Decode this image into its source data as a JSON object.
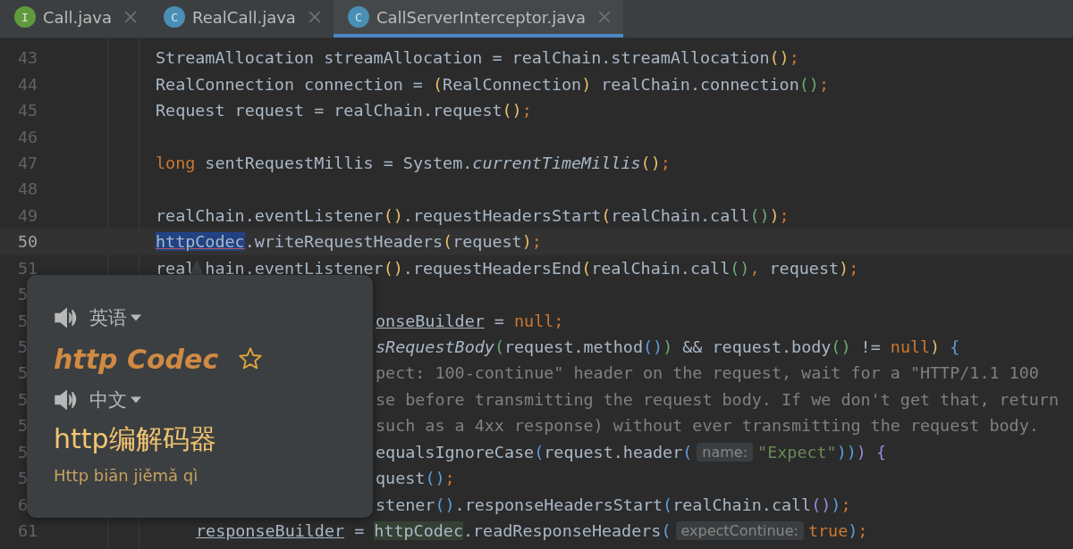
{
  "tabs": [
    {
      "icon_letter": "I",
      "color": "#5f9a3c",
      "label": "Call.java",
      "selected": false
    },
    {
      "icon_letter": "C",
      "color": "#4a8fb5",
      "label": "RealCall.java",
      "selected": false
    },
    {
      "icon_letter": "C",
      "color": "#4a8fb5",
      "label": "CallServerInterceptor.java",
      "selected": true
    }
  ],
  "editor": {
    "lines": [
      {
        "number": "43",
        "kind": "code",
        "current": false,
        "segments": [
          {
            "kind": "plain",
            "text": "StreamAllocation streamAllocation = realChain.streamAllocation"
          },
          {
            "kind": "paren-yellow",
            "text": "()"
          },
          {
            "kind": "punct",
            "text": ";"
          }
        ]
      },
      {
        "number": "44",
        "kind": "code",
        "current": false,
        "segments": [
          {
            "kind": "plain",
            "text": "RealConnection connection = "
          },
          {
            "kind": "paren-yellow",
            "text": "("
          },
          {
            "kind": "plain",
            "text": "RealConnection"
          },
          {
            "kind": "paren-yellow",
            "text": ")"
          },
          {
            "kind": "plain",
            "text": " realChain.connection"
          },
          {
            "kind": "paren-green",
            "text": "()"
          },
          {
            "kind": "punct",
            "text": ";"
          }
        ]
      },
      {
        "number": "45",
        "kind": "code",
        "current": false,
        "segments": [
          {
            "kind": "plain",
            "text": "Request request = realChain.request"
          },
          {
            "kind": "paren-yellow",
            "text": "()"
          },
          {
            "kind": "punct",
            "text": ";"
          }
        ]
      },
      {
        "number": "46",
        "kind": "code",
        "current": false
      },
      {
        "number": "47",
        "kind": "code",
        "current": false,
        "segments": [
          {
            "kind": "keyword",
            "text": "long"
          },
          {
            "kind": "plain",
            "text": " sentRequestMillis = System."
          },
          {
            "kind": "italic",
            "text": "currentTimeMillis"
          },
          {
            "kind": "paren-yellow",
            "text": "()"
          },
          {
            "kind": "punct",
            "text": ";"
          }
        ]
      },
      {
        "number": "48",
        "kind": "code",
        "current": false
      },
      {
        "number": "49",
        "kind": "code",
        "current": false,
        "segments": [
          {
            "kind": "plain",
            "text": "realChain.eventListener"
          },
          {
            "kind": "paren-yellow",
            "text": "()"
          },
          {
            "kind": "plain",
            "text": ".requestHeadersStart"
          },
          {
            "kind": "paren-yellow",
            "text": "("
          },
          {
            "kind": "plain",
            "text": "realChain.call"
          },
          {
            "kind": "paren-green",
            "text": "()"
          },
          {
            "kind": "paren-yellow",
            "text": ")"
          },
          {
            "kind": "punct",
            "text": ";"
          }
        ]
      },
      {
        "number": "50",
        "kind": "code",
        "current": true,
        "segments": [
          {
            "kind": "selected",
            "text": "httpCodec"
          },
          {
            "kind": "plain",
            "text": ".writeRequestHeaders"
          },
          {
            "kind": "paren-yellow",
            "text": "("
          },
          {
            "kind": "plain",
            "text": "request"
          },
          {
            "kind": "paren-yellow",
            "text": ")"
          },
          {
            "kind": "punct",
            "text": ";"
          }
        ]
      },
      {
        "number": "51",
        "kind": "code",
        "current": false,
        "segments": [
          {
            "kind": "plain",
            "text": "real"
          },
          {
            "kind": "gap"
          },
          {
            "kind": "plain",
            "text": "hain.eventListener"
          },
          {
            "kind": "paren-yellow",
            "text": "()"
          },
          {
            "kind": "plain",
            "text": ".requestHeadersEnd"
          },
          {
            "kind": "paren-yellow",
            "text": "("
          },
          {
            "kind": "plain",
            "text": "realChain.call"
          },
          {
            "kind": "paren-green",
            "text": "()"
          },
          {
            "kind": "punct",
            "text": ","
          },
          {
            "kind": "plain",
            "text": " request"
          },
          {
            "kind": "paren-yellow",
            "text": ")"
          },
          {
            "kind": "punct",
            "text": ";"
          }
        ]
      },
      {
        "number": "5",
        "kind": "partial",
        "current": false
      },
      {
        "number": "5",
        "kind": "partial",
        "current": false,
        "segments": [
          {
            "kind": "field",
            "text": "onseBuilder"
          },
          {
            "kind": "plain",
            "text": " = "
          },
          {
            "kind": "keyword",
            "text": "null"
          },
          {
            "kind": "punct",
            "text": ";"
          }
        ]
      },
      {
        "number": "5",
        "kind": "partial",
        "current": false,
        "segments": [
          {
            "kind": "italic",
            "text": "sRequestBody"
          },
          {
            "kind": "paren-green",
            "text": "("
          },
          {
            "kind": "plain",
            "text": "request.method"
          },
          {
            "kind": "paren-blue",
            "text": "()"
          },
          {
            "kind": "paren-green",
            "text": ")"
          },
          {
            "kind": "plain",
            "text": " && request.body"
          },
          {
            "kind": "paren-green",
            "text": "()"
          },
          {
            "kind": "plain",
            "text": " != "
          },
          {
            "kind": "keyword",
            "text": "null"
          },
          {
            "kind": "paren-yellow",
            "text": ")"
          },
          {
            "kind": "paren-blue",
            "text": " {"
          }
        ]
      },
      {
        "number": "5",
        "kind": "partial",
        "current": false,
        "segments": [
          {
            "kind": "comment",
            "text": "pect: 100-continue\" header on the request, wait for a \"HTTP/1.1 100"
          }
        ]
      },
      {
        "number": "5",
        "kind": "partial",
        "current": false,
        "segments": [
          {
            "kind": "comment",
            "text": "se before transmitting the request body. If we don't get that, return"
          }
        ]
      },
      {
        "number": "5",
        "kind": "partial",
        "current": false,
        "segments": [
          {
            "kind": "comment",
            "text": "such as a 4xx response) without ever transmitting the request body."
          }
        ]
      },
      {
        "number": "5",
        "kind": "partial",
        "current": false,
        "segments": [
          {
            "kind": "plain",
            "text": "equalsIgnoreCase"
          },
          {
            "kind": "paren-blue",
            "text": "("
          },
          {
            "kind": "plain",
            "text": "request.header"
          },
          {
            "kind": "paren-blue",
            "text": "("
          },
          {
            "kind": "hint",
            "text": "name:"
          },
          {
            "kind": "string",
            "text": "\"Expect\""
          },
          {
            "kind": "paren-blue",
            "text": ")"
          },
          {
            "kind": "paren-blue",
            "text": ")"
          },
          {
            "kind": "paren-purple",
            "text": ")"
          },
          {
            "kind": "paren-purple",
            "text": " {"
          }
        ]
      },
      {
        "number": "5",
        "kind": "partial",
        "current": false,
        "segments": [
          {
            "kind": "plain",
            "text": "quest"
          },
          {
            "kind": "paren-blue",
            "text": "()"
          },
          {
            "kind": "punct",
            "text": ";"
          }
        ]
      },
      {
        "number": "6",
        "kind": "partial",
        "current": false,
        "segments": [
          {
            "kind": "plain",
            "text": "stener"
          },
          {
            "kind": "paren-blue",
            "text": "()"
          },
          {
            "kind": "plain",
            "text": ".responseHeadersStart"
          },
          {
            "kind": "paren-blue",
            "text": "("
          },
          {
            "kind": "plain",
            "text": "realChain.call"
          },
          {
            "kind": "paren-purple",
            "text": "()"
          },
          {
            "kind": "paren-blue",
            "text": ")"
          },
          {
            "kind": "punct",
            "text": ";"
          }
        ]
      },
      {
        "number": "61",
        "kind": "nested",
        "current": false,
        "segments": [
          {
            "kind": "field",
            "text": "responseBuilder"
          },
          {
            "kind": "plain",
            "text": " = "
          },
          {
            "kind": "usage",
            "text": "httpCodec"
          },
          {
            "kind": "plain",
            "text": ".readResponseHeaders"
          },
          {
            "kind": "paren-blue",
            "text": "("
          },
          {
            "kind": "hint",
            "text": "expectContinue:"
          },
          {
            "kind": "keyword",
            "text": "true"
          },
          {
            "kind": "paren-blue",
            "text": ")"
          },
          {
            "kind": "punct",
            "text": ";"
          }
        ]
      }
    ]
  },
  "translation_popup": {
    "source_language": "英语",
    "term": "http Codec",
    "favorited": false,
    "target_language": "中文",
    "translation": "http编解码器",
    "pinyin": "Http biān jiěmǎ qì"
  }
}
